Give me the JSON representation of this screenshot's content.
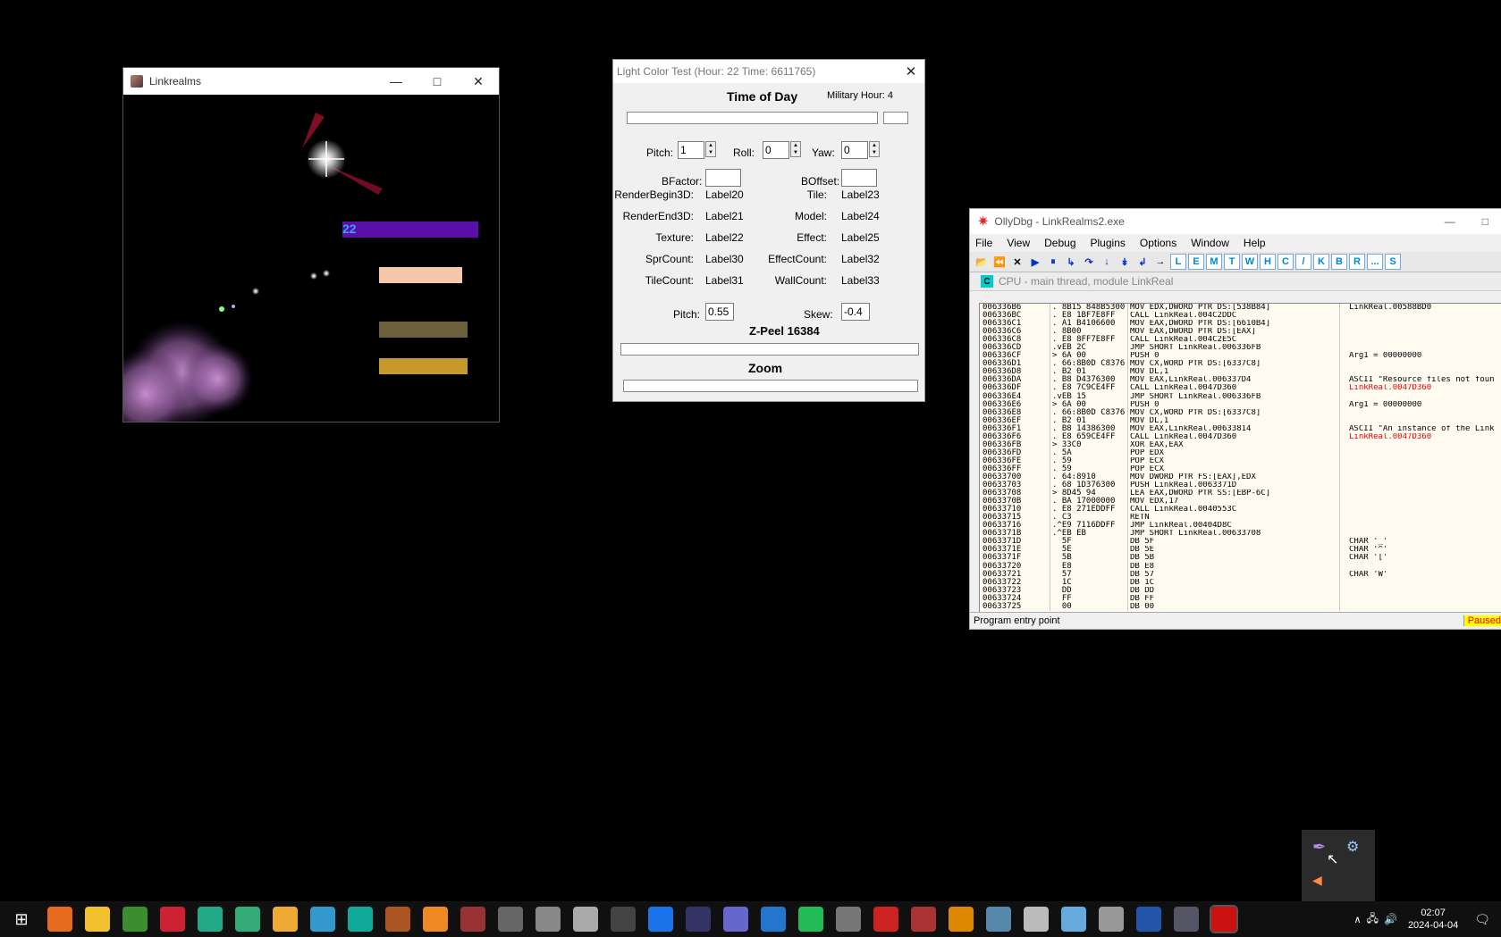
{
  "linkrealms": {
    "title": "Linkrealms",
    "hud_number": "22",
    "bars": [
      {
        "name": "purple-hud-bar",
        "color": "#5a0fa8"
      },
      {
        "name": "peach-bar",
        "color": "#f5c8ac"
      },
      {
        "name": "olive-bar",
        "color": "#6c5f3b"
      },
      {
        "name": "gold-bar",
        "color": "#c69a2a"
      }
    ]
  },
  "light_color_test": {
    "title": "Light Color Test (Hour: 22 Time: 6611765)",
    "time_of_day": "Time of Day",
    "military_hour": "Military Hour: 4",
    "pitch_label": "Pitch:",
    "pitch_value": "1",
    "roll_label": "Roll:",
    "roll_value": "0",
    "yaw_label": "Yaw:",
    "yaw_value": "0",
    "bfactor_label": "BFactor:",
    "boffset_label": "BOffset:",
    "rows": [
      {
        "l": "RenderBegin3D:",
        "lv": "Label20",
        "r": "Tile:",
        "rv": "Label23"
      },
      {
        "l": "RenderEnd3D:",
        "lv": "Label21",
        "r": "Model:",
        "rv": "Label24"
      },
      {
        "l": "Texture:",
        "lv": "Label22",
        "r": "Effect:",
        "rv": "Label25"
      },
      {
        "l": "SprCount:",
        "lv": "Label30",
        "r": "EffectCount:",
        "rv": "Label32"
      },
      {
        "l": "TileCount:",
        "lv": "Label31",
        "r": "WallCount:",
        "rv": "Label33"
      }
    ],
    "pitch2_label": "Pitch:",
    "pitch2_value": "0.55",
    "skew_label": "Skew:",
    "skew_value": "-0.4",
    "zpeel": "Z-Peel 16384",
    "zoom": "Zoom"
  },
  "olly": {
    "title": "OllyDbg - LinkRealms2.exe",
    "menu": [
      "File",
      "View",
      "Debug",
      "Plugins",
      "Options",
      "Window",
      "Help"
    ],
    "toolbar_letters": [
      "L",
      "E",
      "M",
      "T",
      "W",
      "H",
      "C",
      "/",
      "K",
      "B",
      "R",
      "...",
      "S"
    ],
    "cpu_title": "CPU - main thread, module LinkReal",
    "cpu_badge": "C",
    "status": "Program entry point",
    "paused": "Paused",
    "rows": [
      {
        "a": "006336B6",
        "h": ". 8B15 848B5300",
        "i": "MOV EDX,DWORD PTR DS:[538B84]",
        "c": "LinkReal.00588BD0",
        "red": false
      },
      {
        "a": "006336BC",
        "h": ". E8 1BF7E8FF",
        "i": "CALL LinkReal.004C2DDC",
        "c": "",
        "red": false
      },
      {
        "a": "006336C1",
        "h": ". A1 B4106600",
        "i": "MOV EAX,DWORD PTR DS:[6610B4]",
        "c": "",
        "red": false
      },
      {
        "a": "006336C6",
        "h": ". 8B00",
        "i": "MOV EAX,DWORD PTR DS:[EAX]",
        "c": "",
        "red": false
      },
      {
        "a": "006336C8",
        "h": ". E8 8FF7E8FF",
        "i": "CALL LinkReal.004C2E5C",
        "c": "",
        "red": false
      },
      {
        "a": "006336CD",
        "h": ".vEB 2C",
        "i": "JMP SHORT LinkReal.006336FB",
        "c": "",
        "red": false
      },
      {
        "a": "006336CF",
        "h": "> 6A 00",
        "i": "PUSH 0",
        "c": "Arg1 = 00000000",
        "red": false
      },
      {
        "a": "006336D1",
        "h": ". 66:8B0D C8376",
        "i": "MOV CX,WORD PTR DS:[6337C8]",
        "c": "",
        "red": false
      },
      {
        "a": "006336D8",
        "h": ". B2 01",
        "i": "MOV DL,1",
        "c": "",
        "red": false
      },
      {
        "a": "006336DA",
        "h": ". B8 D4376300",
        "i": "MOV EAX,LinkReal.006337D4",
        "c": "ASCII \"Resource files not foun",
        "red": false
      },
      {
        "a": "006336DF",
        "h": ". E8 7C9CE4FF",
        "i": "CALL LinkReal.0047D360",
        "c": "LinkReal.0047D360",
        "red": true
      },
      {
        "a": "006336E4",
        "h": ".vEB 15",
        "i": "JMP SHORT LinkReal.006336FB",
        "c": "",
        "red": false
      },
      {
        "a": "006336E6",
        "h": "> 6A 00",
        "i": "PUSH 0",
        "c": "Arg1 = 00000000",
        "red": false
      },
      {
        "a": "006336E8",
        "h": ". 66:8B0D C8376",
        "i": "MOV CX,WORD PTR DS:[6337C8]",
        "c": "",
        "red": false
      },
      {
        "a": "006336EF",
        "h": ". B2 01",
        "i": "MOV DL,1",
        "c": "",
        "red": false
      },
      {
        "a": "006336F1",
        "h": ". B8 14386300",
        "i": "MOV EAX,LinkReal.00633814",
        "c": "ASCII \"An instance of the Link",
        "red": false
      },
      {
        "a": "006336F6",
        "h": ". E8 659CE4FF",
        "i": "CALL LinkReal.0047D360",
        "c": "LinkReal.0047D360",
        "red": true
      },
      {
        "a": "006336FB",
        "h": "> 33C0",
        "i": "XOR EAX,EAX",
        "c": "",
        "red": false
      },
      {
        "a": "006336FD",
        "h": ". 5A",
        "i": "POP EDX",
        "c": "",
        "red": false
      },
      {
        "a": "006336FE",
        "h": ". 59",
        "i": "POP ECX",
        "c": "",
        "red": false
      },
      {
        "a": "006336FF",
        "h": ". 59",
        "i": "POP ECX",
        "c": "",
        "red": false
      },
      {
        "a": "00633700",
        "h": ". 64:8910",
        "i": "MOV DWORD PTR FS:[EAX],EDX",
        "c": "",
        "red": false
      },
      {
        "a": "00633703",
        "h": ". 68 1D376300",
        "i": "PUSH LinkReal.0063371D",
        "c": "",
        "red": false
      },
      {
        "a": "00633708",
        "h": "> 8D45 94",
        "i": "LEA EAX,DWORD PTR SS:[EBP-6C]",
        "c": "",
        "red": false
      },
      {
        "a": "0063370B",
        "h": ". BA 17000000",
        "i": "MOV EDX,17",
        "c": "",
        "red": false
      },
      {
        "a": "00633710",
        "h": ". E8 271EDDFF",
        "i": "CALL LinkReal.0040553C",
        "c": "",
        "red": false
      },
      {
        "a": "00633715",
        "h": ". C3",
        "i": "RETN",
        "c": "",
        "red": false
      },
      {
        "a": "00633716",
        "h": ".^E9 7116DDFF",
        "i": "JMP LinkReal.00404D8C",
        "c": "",
        "red": false
      },
      {
        "a": "0063371B",
        "h": ".^EB EB",
        "i": "JMP SHORT LinkReal.00633708",
        "c": "",
        "red": false
      },
      {
        "a": "0063371D",
        "h": "  5F",
        "i": "DB 5F",
        "c": "CHAR '_'",
        "red": false
      },
      {
        "a": "0063371E",
        "h": "  5E",
        "i": "DB 5E",
        "c": "CHAR '^'",
        "red": false
      },
      {
        "a": "0063371F",
        "h": "  5B",
        "i": "DB 5B",
        "c": "CHAR '['",
        "red": false
      },
      {
        "a": "00633720",
        "h": "  E8",
        "i": "DB E8",
        "c": "",
        "red": false
      },
      {
        "a": "00633721",
        "h": "  57",
        "i": "DB 57",
        "c": "CHAR 'W'",
        "red": false
      },
      {
        "a": "00633722",
        "h": "  1C",
        "i": "DB 1C",
        "c": "",
        "red": false
      },
      {
        "a": "00633723",
        "h": "  DD",
        "i": "DB DD",
        "c": "",
        "red": false
      },
      {
        "a": "00633724",
        "h": "  FF",
        "i": "DB FF",
        "c": "",
        "red": false
      },
      {
        "a": "00633725",
        "h": "  00",
        "i": "DB 00",
        "c": "",
        "red": false
      }
    ]
  },
  "taskbar": {
    "time": "02:07",
    "date": "2024-04-04",
    "icons": [
      "firefox-icon",
      "file-explorer-icon",
      "app-green-icon",
      "app-red-icon",
      "notepad-icon",
      "tree-app-icon",
      "watering-can-icon",
      "refresh-app-icon",
      "search-app-icon",
      "game-icon-1",
      "orange-app-icon",
      "game-portrait-icon",
      "obs-icon",
      "steam-like-icon",
      "gear-app-icon",
      "gamepad-small-icon",
      "chrome-icon",
      "art-app-icon",
      "adobe-like-icon",
      "zoom-like-icon",
      "green-app-icon",
      "disc-icon",
      "red-app-icon",
      "calendar-app-icon",
      "halflife-icon",
      "globe-icon",
      "gamepad-icon",
      "windmill-icon",
      "moon-icon",
      "lock-icon",
      "ollydbg-taskbar-icon",
      "ollydbg-active-icon"
    ],
    "tray_flyout": [
      "feather-icon",
      "steam-icon",
      "speaker-app-icon"
    ]
  }
}
